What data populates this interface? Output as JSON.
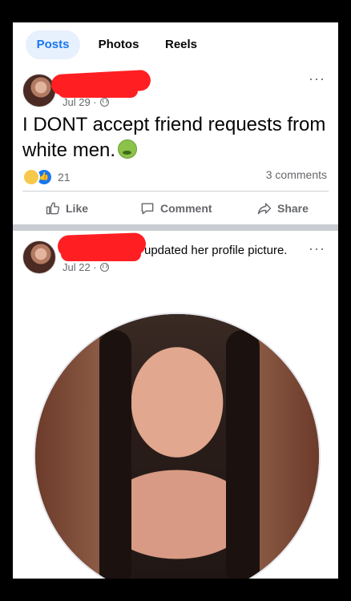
{
  "tabs": [
    {
      "label": "Posts",
      "active": true
    },
    {
      "label": "Photos",
      "active": false
    },
    {
      "label": "Reels",
      "active": false
    }
  ],
  "post1": {
    "date": "Jul 29 ·",
    "text": "I DONT accept friend requests from white men.",
    "emoji_icon": "nauseated-face-icon",
    "reaction_count": "21",
    "comments_label": "3 comments",
    "actions": {
      "like": "Like",
      "comment": "Comment",
      "share": "Share"
    },
    "more": "···"
  },
  "post2": {
    "action_text": "updated her profile picture.",
    "date": "Jul 22 ·",
    "more": "···"
  },
  "colors": {
    "accent": "#1877f2",
    "redaction": "#ff1f23",
    "muted": "#65676b"
  }
}
